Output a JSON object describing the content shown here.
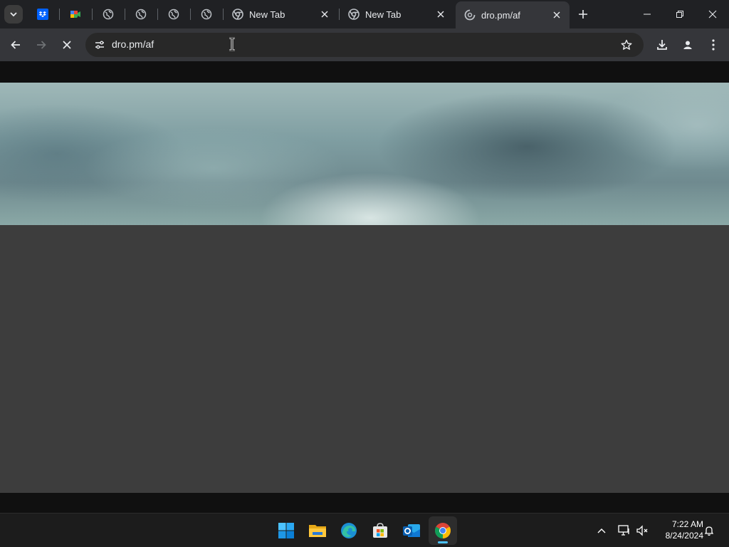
{
  "browser": {
    "tabs": [
      {
        "title": "New Tab",
        "favicon": "chrome-icon",
        "active": false
      },
      {
        "title": "New Tab",
        "favicon": "chrome-icon",
        "active": false
      },
      {
        "title": "dro.pm/af",
        "favicon": "loading-spinner-icon",
        "active": true
      }
    ],
    "pinned_tabs": [
      "dropbox-icon",
      "google-meet-icon",
      "globe-icon",
      "globe-icon",
      "globe-icon",
      "globe-icon"
    ],
    "address_bar": {
      "url": "dro.pm/af"
    },
    "accent": "#8ab4f8"
  },
  "page": {
    "hero_image": "cloudy-sky-image"
  },
  "taskbar": {
    "apps": [
      "windows-start-icon",
      "file-explorer-icon",
      "edge-icon",
      "microsoft-store-icon",
      "outlook-icon",
      "chrome-icon"
    ],
    "active_app": "chrome-icon",
    "clock": {
      "time": "7:22 AM",
      "date": "8/24/2024"
    }
  }
}
